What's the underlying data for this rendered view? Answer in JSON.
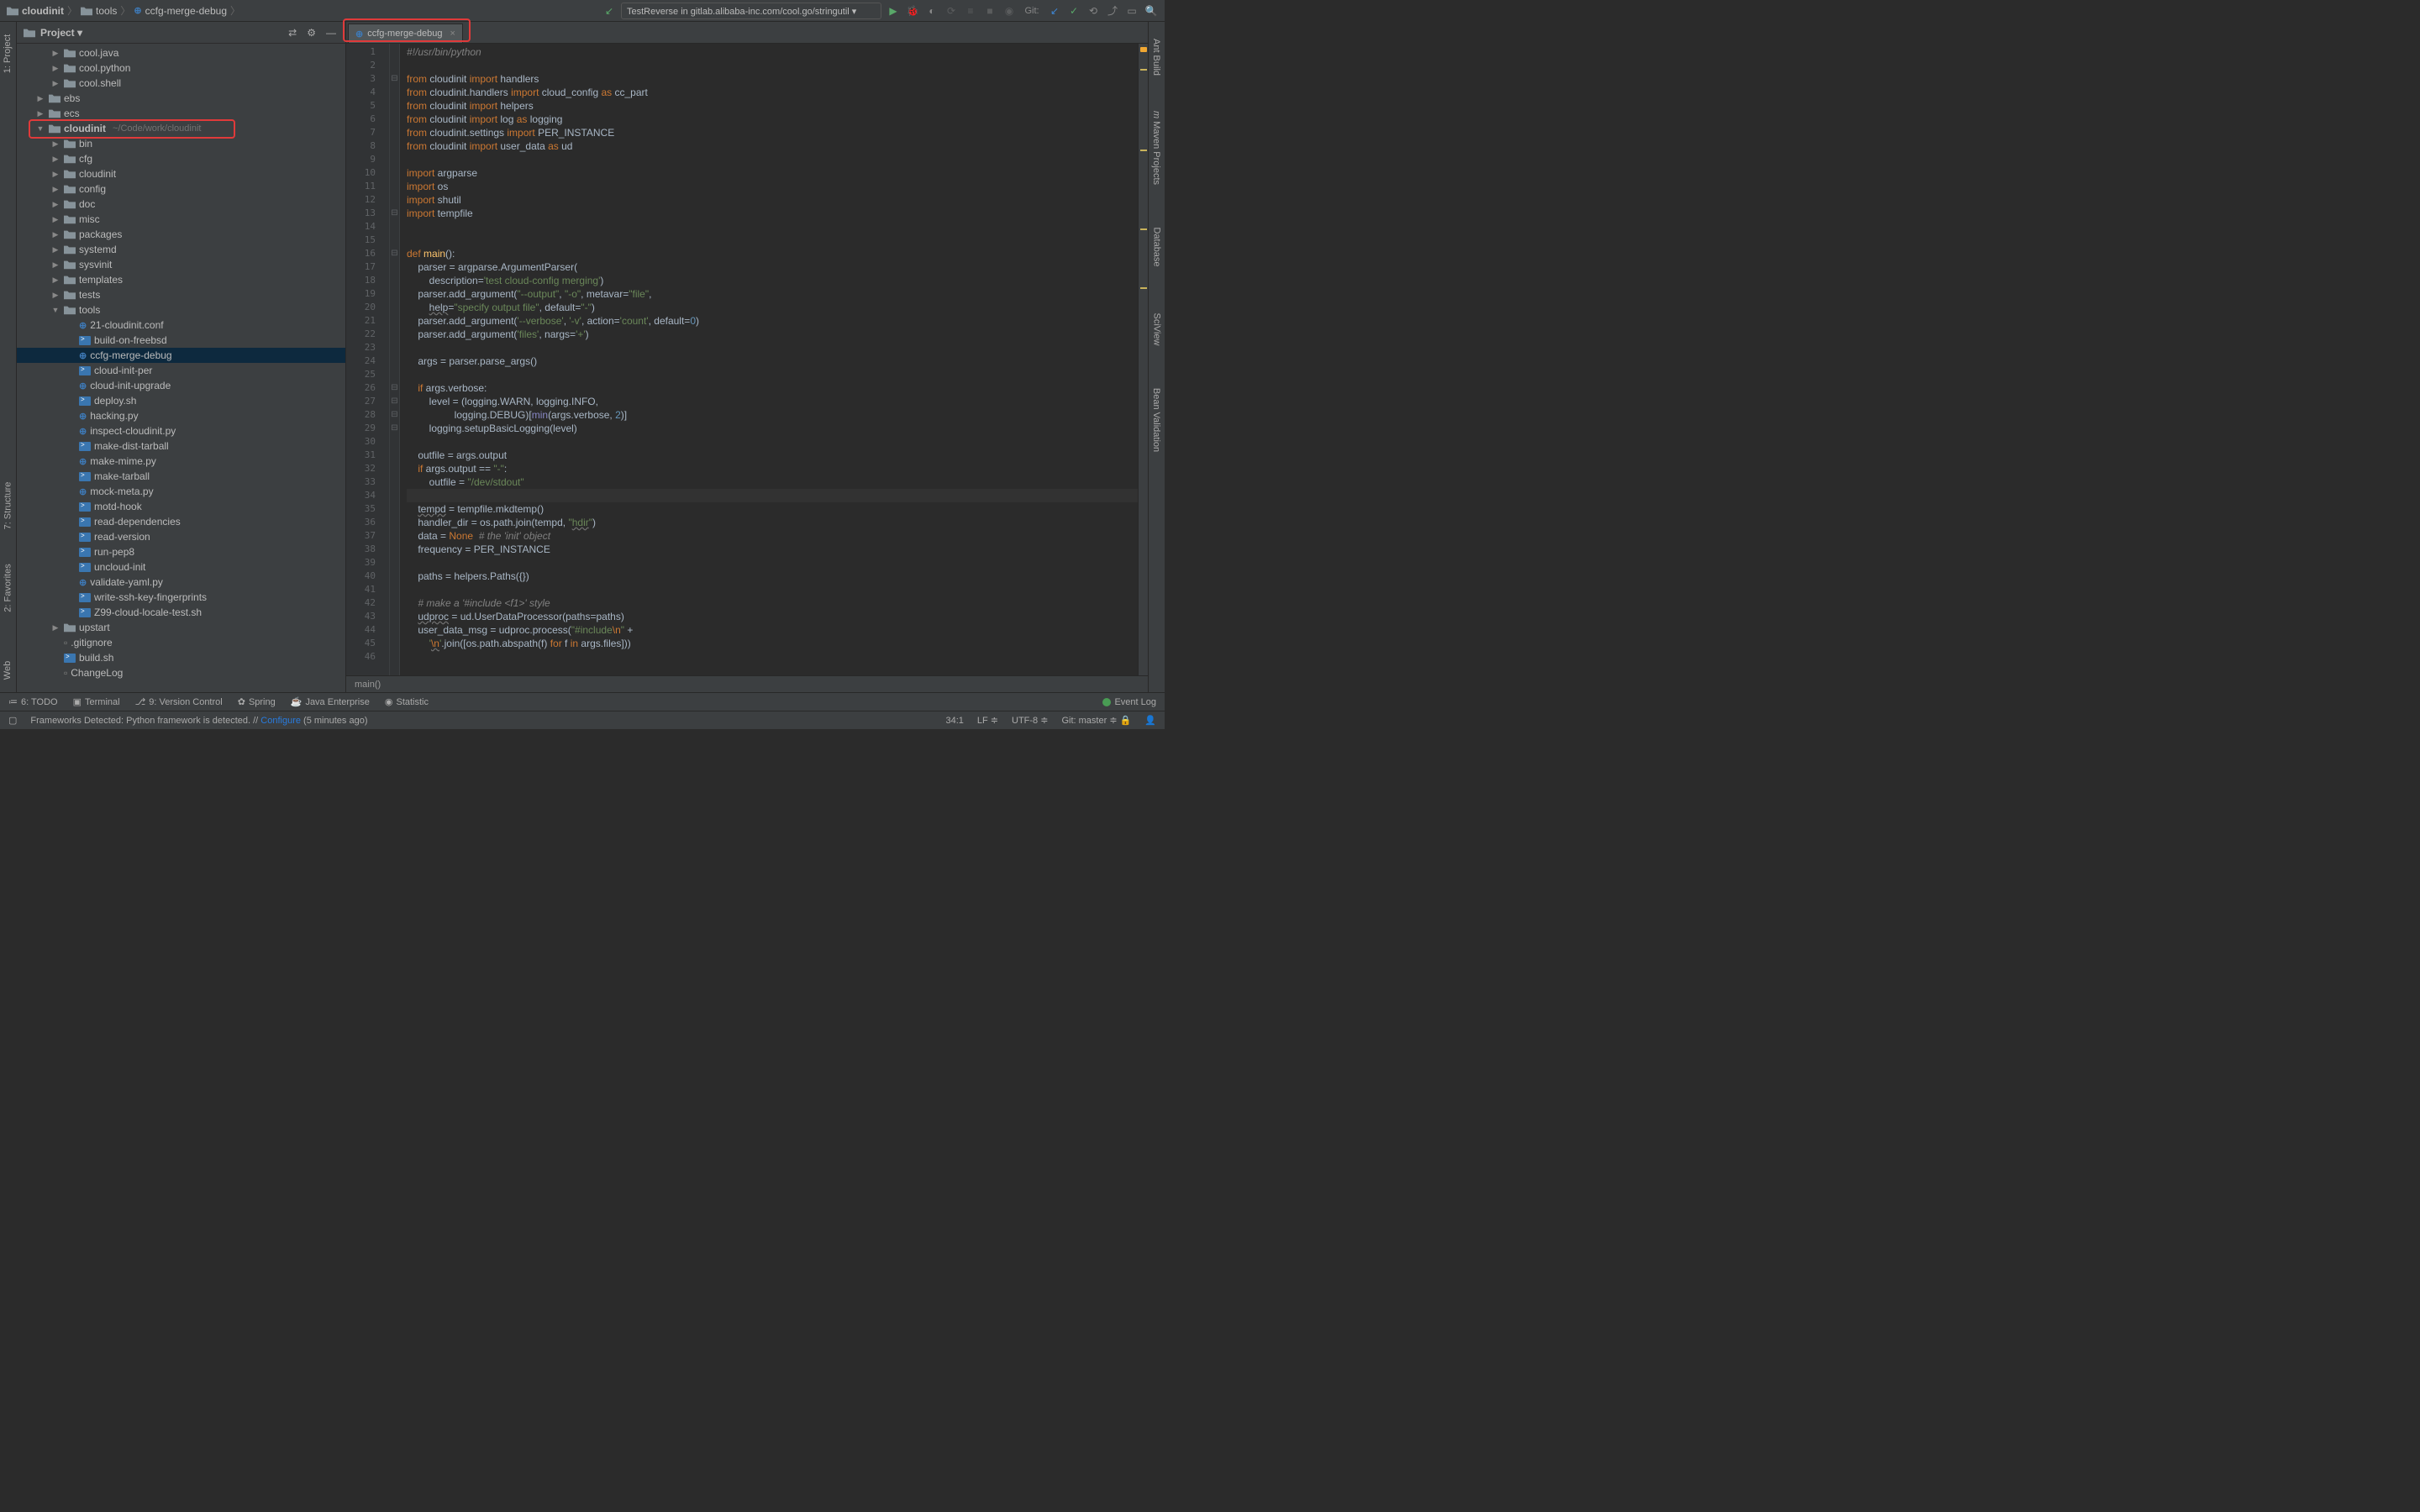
{
  "breadcrumbs": {
    "a": "cloudinit",
    "b": "tools",
    "c": "ccfg-merge-debug"
  },
  "runConfig": "TestReverse in gitlab.alibaba-inc.com/cool.go/stringutil",
  "gitLabel": "Git:",
  "project": {
    "headerTitle": "Project",
    "items": [
      {
        "ind": 1,
        "arrow": "▶",
        "icon": "folder",
        "label": "cool.java"
      },
      {
        "ind": 1,
        "arrow": "▶",
        "icon": "folder",
        "label": "cool.python"
      },
      {
        "ind": 1,
        "arrow": "▶",
        "icon": "folder",
        "label": "cool.shell"
      },
      {
        "ind": 0,
        "arrow": "▶",
        "icon": "folder",
        "label": "ebs"
      },
      {
        "ind": 0,
        "arrow": "▶",
        "icon": "folder",
        "label": "ecs"
      },
      {
        "ind": 0,
        "arrow": "▼",
        "icon": "folder",
        "label": "cloudinit",
        "path": "~/Code/work/cloudinit",
        "highlight": true
      },
      {
        "ind": 1,
        "arrow": "▶",
        "icon": "folder",
        "label": "bin"
      },
      {
        "ind": 1,
        "arrow": "▶",
        "icon": "folder",
        "label": "cfg"
      },
      {
        "ind": 1,
        "arrow": "▶",
        "icon": "folder",
        "label": "cloudinit"
      },
      {
        "ind": 1,
        "arrow": "▶",
        "icon": "folder",
        "label": "config"
      },
      {
        "ind": 1,
        "arrow": "▶",
        "icon": "folder",
        "label": "doc"
      },
      {
        "ind": 1,
        "arrow": "▶",
        "icon": "folder",
        "label": "misc"
      },
      {
        "ind": 1,
        "arrow": "▶",
        "icon": "folder",
        "label": "packages"
      },
      {
        "ind": 1,
        "arrow": "▶",
        "icon": "folder",
        "label": "systemd"
      },
      {
        "ind": 1,
        "arrow": "▶",
        "icon": "folder",
        "label": "sysvinit"
      },
      {
        "ind": 1,
        "arrow": "▶",
        "icon": "folder",
        "label": "templates"
      },
      {
        "ind": 1,
        "arrow": "▶",
        "icon": "folder",
        "label": "tests"
      },
      {
        "ind": 1,
        "arrow": "▼",
        "icon": "folder",
        "label": "tools"
      },
      {
        "ind": 2,
        "arrow": "",
        "icon": "py",
        "label": "21-cloudinit.conf"
      },
      {
        "ind": 2,
        "arrow": "",
        "icon": "sh",
        "label": "build-on-freebsd"
      },
      {
        "ind": 2,
        "arrow": "",
        "icon": "py",
        "label": "ccfg-merge-debug",
        "selected": true
      },
      {
        "ind": 2,
        "arrow": "",
        "icon": "sh",
        "label": "cloud-init-per"
      },
      {
        "ind": 2,
        "arrow": "",
        "icon": "py",
        "label": "cloud-init-upgrade"
      },
      {
        "ind": 2,
        "arrow": "",
        "icon": "sh",
        "label": "deploy.sh"
      },
      {
        "ind": 2,
        "arrow": "",
        "icon": "py",
        "label": "hacking.py"
      },
      {
        "ind": 2,
        "arrow": "",
        "icon": "py",
        "label": "inspect-cloudinit.py"
      },
      {
        "ind": 2,
        "arrow": "",
        "icon": "sh",
        "label": "make-dist-tarball"
      },
      {
        "ind": 2,
        "arrow": "",
        "icon": "py",
        "label": "make-mime.py"
      },
      {
        "ind": 2,
        "arrow": "",
        "icon": "sh",
        "label": "make-tarball"
      },
      {
        "ind": 2,
        "arrow": "",
        "icon": "py",
        "label": "mock-meta.py"
      },
      {
        "ind": 2,
        "arrow": "",
        "icon": "sh",
        "label": "motd-hook"
      },
      {
        "ind": 2,
        "arrow": "",
        "icon": "sh",
        "label": "read-dependencies"
      },
      {
        "ind": 2,
        "arrow": "",
        "icon": "sh",
        "label": "read-version"
      },
      {
        "ind": 2,
        "arrow": "",
        "icon": "sh",
        "label": "run-pep8"
      },
      {
        "ind": 2,
        "arrow": "",
        "icon": "sh",
        "label": "uncloud-init"
      },
      {
        "ind": 2,
        "arrow": "",
        "icon": "py",
        "label": "validate-yaml.py"
      },
      {
        "ind": 2,
        "arrow": "",
        "icon": "sh",
        "label": "write-ssh-key-fingerprints"
      },
      {
        "ind": 2,
        "arrow": "",
        "icon": "sh",
        "label": "Z99-cloud-locale-test.sh"
      },
      {
        "ind": 1,
        "arrow": "▶",
        "icon": "folder",
        "label": "upstart"
      },
      {
        "ind": 1,
        "arrow": "",
        "icon": "file",
        "label": ".gitignore"
      },
      {
        "ind": 1,
        "arrow": "",
        "icon": "sh",
        "label": "build.sh"
      },
      {
        "ind": 1,
        "arrow": "",
        "icon": "file",
        "label": "ChangeLog"
      }
    ]
  },
  "tab": {
    "name": "ccfg-merge-debug"
  },
  "code": [
    {
      "n": 1,
      "fold": "",
      "html": "<span class='cm'>#!/usr/bin/python</span>"
    },
    {
      "n": 2,
      "fold": "",
      "html": ""
    },
    {
      "n": 3,
      "fold": "⊟",
      "html": "<span class='kw'>from</span> cloudinit <span class='kw'>import</span> handlers"
    },
    {
      "n": 4,
      "fold": "",
      "html": "<span class='kw'>from</span> cloudinit.handlers <span class='kw'>import</span> cloud_config <span class='kw'>as</span> cc_part"
    },
    {
      "n": 5,
      "fold": "",
      "html": "<span class='kw'>from</span> cloudinit <span class='kw'>import</span> helpers"
    },
    {
      "n": 6,
      "fold": "",
      "html": "<span class='kw'>from</span> cloudinit <span class='kw'>import</span> log <span class='kw'>as</span> logging"
    },
    {
      "n": 7,
      "fold": "",
      "html": "<span class='kw'>from</span> cloudinit.settings <span class='kw'>import</span> PER_INSTANCE"
    },
    {
      "n": 8,
      "fold": "",
      "html": "<span class='kw'>from</span> cloudinit <span class='kw'>import</span> user_data <span class='kw'>as</span> ud"
    },
    {
      "n": 9,
      "fold": "",
      "html": ""
    },
    {
      "n": 10,
      "fold": "",
      "html": "<span class='kw'>import</span> argparse"
    },
    {
      "n": 11,
      "fold": "",
      "html": "<span class='kw'>import</span> os"
    },
    {
      "n": 12,
      "fold": "",
      "html": "<span class='kw'>import</span> shutil"
    },
    {
      "n": 13,
      "fold": "⊟",
      "html": "<span class='kw'>import</span> tempfile"
    },
    {
      "n": 14,
      "fold": "",
      "html": ""
    },
    {
      "n": 15,
      "fold": "",
      "html": ""
    },
    {
      "n": 16,
      "fold": "⊟",
      "html": "<span class='kw'>def</span> <span class='fn'>main</span>():"
    },
    {
      "n": 17,
      "fold": "",
      "html": "    parser = argparse.ArgumentParser("
    },
    {
      "n": 18,
      "fold": "",
      "html": "        <span class='id'>description</span>=<span class='str'>'test cloud-config merging'</span>)"
    },
    {
      "n": 19,
      "fold": "",
      "html": "    parser.add_argument(<span class='str'>\"--output\"</span>, <span class='str'>\"-o\"</span>, <span class='id'>metavar</span>=<span class='str'>\"file\"</span>,"
    },
    {
      "n": 20,
      "fold": "",
      "html": "        <span class='id underl'>help</span>=<span class='str'>\"specify output file\"</span>, <span class='id'>default</span>=<span class='str'>\"-\"</span>)"
    },
    {
      "n": 21,
      "fold": "",
      "html": "    parser.add_argument(<span class='str'>'--verbose'</span>, <span class='str'>'-v'</span>, <span class='id'>action</span>=<span class='str'>'count'</span>, <span class='id'>default</span>=<span class='num'>0</span>)"
    },
    {
      "n": 22,
      "fold": "",
      "html": "    parser.add_argument(<span class='str'>'files'</span>, <span class='id'>nargs</span>=<span class='str'>'+'</span>)"
    },
    {
      "n": 23,
      "fold": "",
      "html": ""
    },
    {
      "n": 24,
      "fold": "",
      "html": "    args = parser.parse_args()"
    },
    {
      "n": 25,
      "fold": "",
      "html": ""
    },
    {
      "n": 26,
      "fold": "⊟",
      "html": "    <span class='kw'>if</span> args.verbose:"
    },
    {
      "n": 27,
      "fold": "⊟",
      "html": "        level = (logging.WARN, logging.INFO,"
    },
    {
      "n": 28,
      "fold": "⊟",
      "html": "                 logging.DEBUG)[<span class='builtin'>min</span>(args.verbose, <span class='num'>2</span>)]"
    },
    {
      "n": 29,
      "fold": "⊟",
      "html": "        logging.setupBasicLogging(level)"
    },
    {
      "n": 30,
      "fold": "",
      "html": ""
    },
    {
      "n": 31,
      "fold": "",
      "html": "    outfile = args.output"
    },
    {
      "n": 32,
      "fold": "",
      "html": "    <span class='kw'>if</span> args.output == <span class='str'>\"-\"</span>:"
    },
    {
      "n": 33,
      "fold": "",
      "html": "        outfile = <span class='str'>\"/dev/stdout\"</span>"
    },
    {
      "n": 34,
      "fold": "",
      "html": "",
      "caret": true
    },
    {
      "n": 35,
      "fold": "",
      "html": "    <span class='id underl'>tempd</span> = tempfile.mkdtemp()"
    },
    {
      "n": 36,
      "fold": "",
      "html": "    handler_dir = os.path.join(tempd, <span class='str'>\"<span class='underl'>hdir</span>\"</span>)"
    },
    {
      "n": 37,
      "fold": "",
      "html": "    data = <span class='kw'>None</span>  <span class='cm'># the 'init' object</span>"
    },
    {
      "n": 38,
      "fold": "",
      "html": "    frequency = PER_INSTANCE"
    },
    {
      "n": 39,
      "fold": "",
      "html": ""
    },
    {
      "n": 40,
      "fold": "",
      "html": "    paths = helpers.Paths({})"
    },
    {
      "n": 41,
      "fold": "",
      "html": ""
    },
    {
      "n": 42,
      "fold": "",
      "html": "    <span class='cm'># make a '#include &lt;f1&gt;' style</span>"
    },
    {
      "n": 43,
      "fold": "",
      "html": "    <span class='id underl'>udproc</span> = ud.UserDataProcessor(<span class='id'>paths</span>=paths)"
    },
    {
      "n": 44,
      "fold": "",
      "html": "    user_data_msg = udproc.process(<span class='str'>\"#include<span class='escape'>\\n</span>\"</span> +"
    },
    {
      "n": 45,
      "fold": "",
      "html": "        <span class='str'>'<span class='escape'><span class='underl'>\\n</span></span>'</span>.join([os.path.abspath(f) <span class='kw'>for</span> f <span class='kw'>in</span> args.files]))"
    },
    {
      "n": 46,
      "fold": "",
      "html": ""
    }
  ],
  "breadcrumbBar": "main()",
  "bottomTools": {
    "todo": "6: TODO",
    "terminal": "Terminal",
    "vcs": "9: Version Control",
    "spring": "Spring",
    "java": "Java Enterprise",
    "statistic": "Statistic",
    "eventlog": "Event Log"
  },
  "leftRail": {
    "project": "1: Project",
    "structure": "7: Structure",
    "favorites": "2: Favorites",
    "web": "Web"
  },
  "rightRail": {
    "ant": "Ant Build",
    "maven": "Maven Projects",
    "database": "Database",
    "sciview": "SciView",
    "bean": "Bean Validation"
  },
  "status": {
    "msg_a": "Frameworks Detected: Python framework is detected. // ",
    "msg_link": "Configure",
    "msg_b": " (5 minutes ago)",
    "pos": "34:1",
    "lf": "LF",
    "enc": "UTF-8",
    "branch": "Git: master"
  }
}
